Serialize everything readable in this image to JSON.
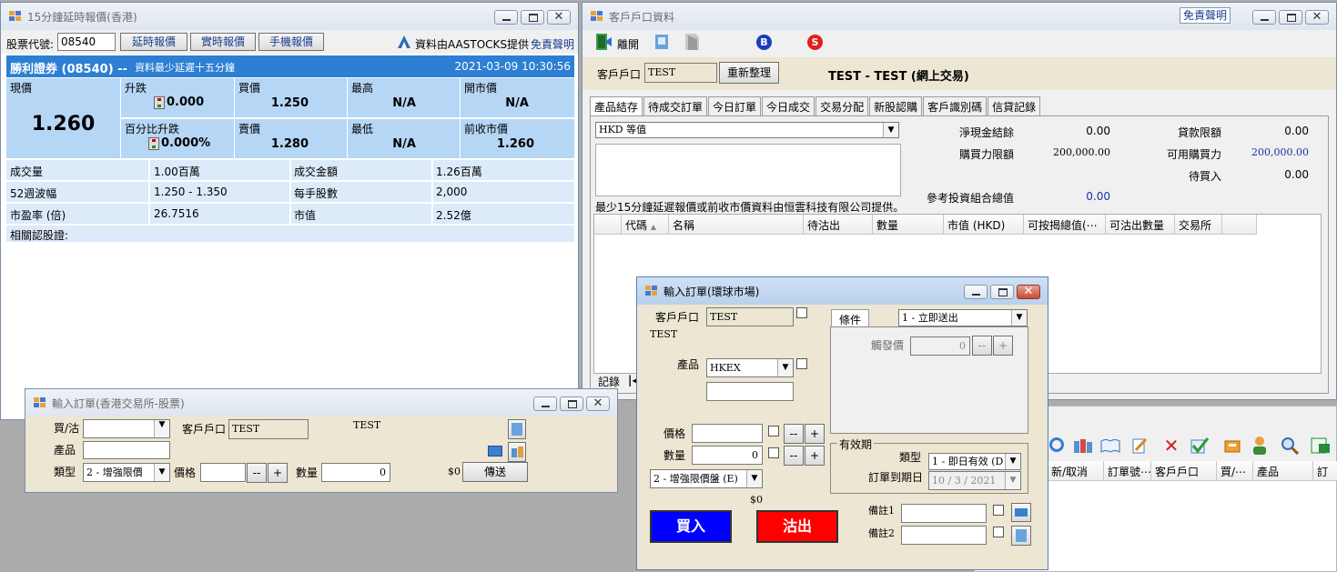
{
  "quote_window": {
    "title": "15分鐘延時報價(香港)",
    "stock_code_label": "股票代號:",
    "stock_code_value": "08540",
    "btn_delayed": "延時報價",
    "btn_realtime": "實時報價",
    "btn_mobile": "手機報價",
    "provider": "資料由AASTOCKS提供",
    "disclaimer": "免責聲明",
    "header_name": "勝利證券 (08540) --",
    "header_note": "資料最少延遲十五分鐘",
    "header_time": "2021-03-09 10:30:56",
    "price_label": "現價",
    "price_value": "1.260",
    "change_label": "升跌",
    "change_value": "0.000",
    "pct_label": "百分比升跌",
    "pct_value": "0.000%",
    "bid_label": "買價",
    "bid_value": "1.250",
    "ask_label": "賣價",
    "ask_value": "1.280",
    "high_label": "最高",
    "high_value": "N/A",
    "low_label": "最低",
    "low_value": "N/A",
    "open_label": "開市價",
    "open_value": "N/A",
    "prevclose_label": "前收市價",
    "prevclose_value": "1.260",
    "volume_label": "成交量",
    "volume_value": "1.00百萬",
    "turnover_label": "成交金額",
    "turnover_value": "1.26百萬",
    "range52_label": "52週波幅",
    "range52_value": "1.250 - 1.350",
    "lot_label": "每手股數",
    "lot_value": "2,000",
    "pe_label": "市盈率 (倍)",
    "pe_value": "26.7516",
    "mcap_label": "市值",
    "mcap_value": "2.52億",
    "warrants_label": "相關認股證:"
  },
  "client_window": {
    "title": "客戶戶口資料",
    "disclaimer_btn": "免責聲明",
    "exit_label": "離開",
    "account_label": "客戶戶口",
    "account_value": "TEST",
    "refresh_btn": "重新整理",
    "account_name": "TEST - TEST (網上交易)",
    "tabs": [
      "產品結存",
      "待成交訂單",
      "今日訂單",
      "今日成交",
      "交易分配",
      "新股認購",
      "客戶識別碼",
      "信貸記錄"
    ],
    "currency_combo": "HKD 等值",
    "net_cash_label": "淨現金結餘",
    "net_cash_value": "0.00",
    "loan_limit_label": "貸款限額",
    "loan_limit_value": "0.00",
    "buy_power_limit_label": "購買力限額",
    "buy_power_limit_value": "200,000.00",
    "avail_buy_power_label": "可用購買力",
    "avail_buy_power_value": "200,000.00",
    "pending_buy_label": "待買入",
    "pending_buy_value": "0.00",
    "portfolio_label": "參考投資組合總值",
    "portfolio_value": "0.00",
    "data_note": "最少15分鐘延遲報價或前收市價資料由恒雲科技有限公司提供。",
    "columns": [
      "代碼",
      "名稱",
      "待沽出",
      "數量",
      "市值 (HKD)",
      "可按揭總值(⋯",
      "可沽出數量",
      "交易所"
    ],
    "records_label": "記錄"
  },
  "hk_order_window": {
    "title": "輸入訂單(香港交易所-股票)",
    "side_label": "買/沽",
    "account_label": "客戶戶口",
    "account_value": "TEST",
    "account_name": "TEST",
    "product_label": "產品",
    "type_label": "類型",
    "type_value": "2 - 增強限價",
    "price_label": "價格",
    "qty_label": "數量",
    "qty_value": "0",
    "amount": "$0",
    "send_btn": "傳送"
  },
  "global_order_window": {
    "title": "輸入訂單(環球市場)",
    "account_label": "客戶戶口",
    "account_value": "TEST",
    "account_name": "TEST",
    "product_label": "產品",
    "product_value": "HKEX",
    "price_label": "價格",
    "qty_label": "數量",
    "qty_value": "0",
    "order_type_value": "2 - 增強限價盤 (E)",
    "amount": "$0",
    "condition_tab": "條件",
    "condition_value": "1 - 立即送出",
    "trigger_label": "觸發價",
    "trigger_value": "0",
    "validity_label": "有效期",
    "validity_type_label": "類型",
    "validity_type_value": "1 - 即日有效 (D",
    "expiry_label": "訂單到期日",
    "expiry_value": "10 /  3 / 2021",
    "remark1_label": "備註1",
    "remark2_label": "備註2",
    "buy_btn": "買入",
    "sell_btn": "沽出",
    "step_minus": "--",
    "step_plus": "+"
  },
  "order_list_window": {
    "columns": [
      "新/取消",
      "訂單號⋯",
      "客戶戶口",
      "買/⋯",
      "產品",
      "訂"
    ]
  },
  "colors": {
    "quote_header_bg": "#2d7fd3",
    "quote_cell_bg": "#b6d6f6",
    "quote_row_bg": "#dceafa",
    "buy_blue": "#0000ff",
    "sell_red": "#ff0000"
  }
}
